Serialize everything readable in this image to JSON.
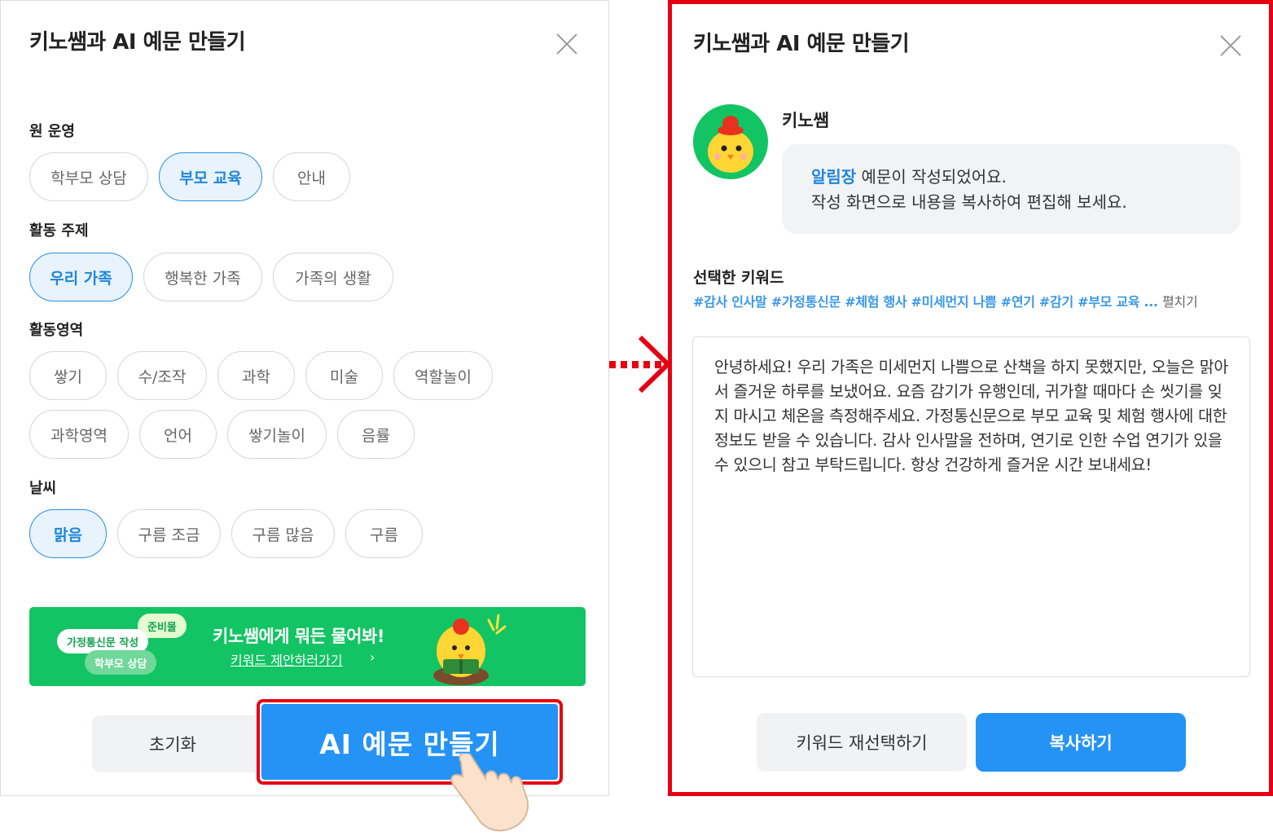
{
  "left": {
    "title": "키노쌤과 AI 예문 만들기",
    "sections": [
      {
        "label": "원 운영",
        "chips": [
          {
            "text": "학부모 상담",
            "selected": false
          },
          {
            "text": "부모 교육",
            "selected": true
          },
          {
            "text": "안내",
            "selected": false
          }
        ]
      },
      {
        "label": "활동 주제",
        "chips": [
          {
            "text": "우리 가족",
            "selected": true
          },
          {
            "text": "행복한 가족",
            "selected": false
          },
          {
            "text": "가족의 생활",
            "selected": false
          }
        ]
      },
      {
        "label": "활동영역",
        "chips": [
          {
            "text": "쌓기",
            "selected": false
          },
          {
            "text": "수/조작",
            "selected": false
          },
          {
            "text": "과학",
            "selected": false
          },
          {
            "text": "미술",
            "selected": false
          },
          {
            "text": "역할놀이",
            "selected": false
          }
        ],
        "chips2": [
          {
            "text": "과학영역",
            "selected": false
          },
          {
            "text": "언어",
            "selected": false
          },
          {
            "text": "쌓기놀이",
            "selected": false
          },
          {
            "text": "음률",
            "selected": false
          }
        ]
      },
      {
        "label": "날씨",
        "chips": [
          {
            "text": "맑음",
            "selected": true
          },
          {
            "text": "구름 조금",
            "selected": false
          },
          {
            "text": "구름 많음",
            "selected": false
          },
          {
            "text": "구름",
            "selected": false
          }
        ]
      }
    ],
    "banner": {
      "pill_1": "준비물",
      "pill_2": "가정통신문 작성",
      "pill_3": "학부모 상담",
      "title": "키노쌤에게 뭐든 물어봐!",
      "link": "키워드 제안하러가기",
      "chevron": "›"
    },
    "reset_label": "초기화",
    "make_label": "AI 예문 만들기"
  },
  "right": {
    "title": "키노쌤과 AI 예문 만들기",
    "sender": "키노쌤",
    "bubble_highlight": "알림장",
    "bubble_rest": " 예문이 작성되었어요.",
    "bubble_line2": "작성 화면으로 내용을 복사하여 편집해 보세요.",
    "keyword_label": "선택한 키워드",
    "keyword_tags": "#감사 인사말 #가정통신문 #체험 행사 #미세먼지 나쁨 #연기 #감기 #부모 교육 ...",
    "keyword_more": "펼치기",
    "result_text": "안녕하세요! 우리 가족은 미세먼지 나쁨으로 산책을 하지 못했지만, 오늘은 맑아서 즐거운 하루를 보냈어요. 요즘 감기가 유행인데, 귀가할 때마다 손 씻기를 잊지 마시고 체온을 측정해주세요. 가정통신문으로 부모 교육 및 체험 행사에 대한 정보도 받을 수 있습니다. 감사 인사말을 전하며, 연기로 인한 수업 연기가 있을 수 있으니 참고 부탁드립니다. 항상 건강하게 즐거운 시간 보내세요!",
    "reselect_label": "키워드 재선택하기",
    "copy_label": "복사하기"
  },
  "icons": {
    "close": "close-icon",
    "hand": "pointer-hand-icon",
    "arrow": "arrow-right-icon",
    "mascot": "chick-mascot-icon"
  },
  "colors": {
    "primary": "#2592f5",
    "highlight_frame": "#e50012",
    "banner": "#12c463",
    "selected_chip_bg": "#e8f3fc"
  }
}
